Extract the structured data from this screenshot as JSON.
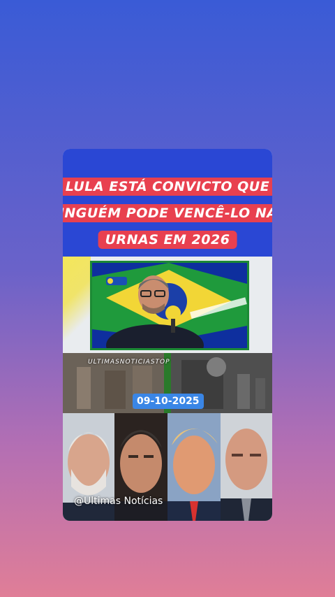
{
  "post": {
    "headline_lines": [
      "LULA ESTÁ CONVICTO QUE",
      "NINGUÉM PODE VENCÊ-LO NAS",
      "URNAS EM 2026"
    ],
    "strip_label": "ULTIMASNOTICIASTOP",
    "date": "09-10-2025",
    "watermark": "@Ultimas Notícias"
  },
  "colors": {
    "background_top": "#3a5bd6",
    "background_bottom": "#e07e97",
    "headline_bg": "#2a47d4",
    "headline_box": "#e8404f",
    "date_badge": "#3a86e6"
  }
}
